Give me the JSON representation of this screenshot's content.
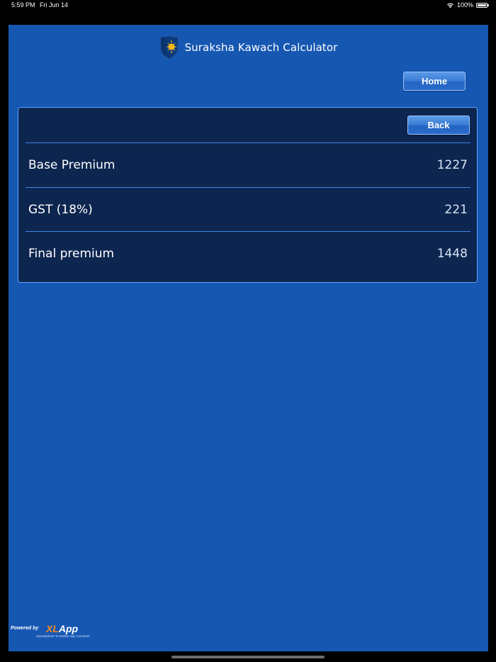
{
  "status_bar": {
    "time": "5:59 PM",
    "date": "Fri Jun 14",
    "battery": "100%",
    "wifi_icon": "wifi-icon",
    "battery_icon": "battery-icon"
  },
  "header": {
    "title": "Suraksha Kawach Calculator",
    "logo_icon": "shield-sun-logo"
  },
  "buttons": {
    "home_label": "Home",
    "back_label": "Back"
  },
  "results": {
    "rows": [
      {
        "label": "Base Premium",
        "value": "1227"
      },
      {
        "label": "GST (18%)",
        "value": "221"
      },
      {
        "label": "Final premium",
        "value": "1448"
      }
    ]
  },
  "footer": {
    "powered_by": "Powered by",
    "brand_xl": "XL",
    "brand_app": "App",
    "tagline": "Spreadsheet To Mobile App Converter"
  },
  "colors": {
    "background": "#1657b2",
    "panel": "#0d2650",
    "panel_border": "#5fa0ff",
    "button": "#2a6bca",
    "brand_accent": "#f08a1c"
  }
}
